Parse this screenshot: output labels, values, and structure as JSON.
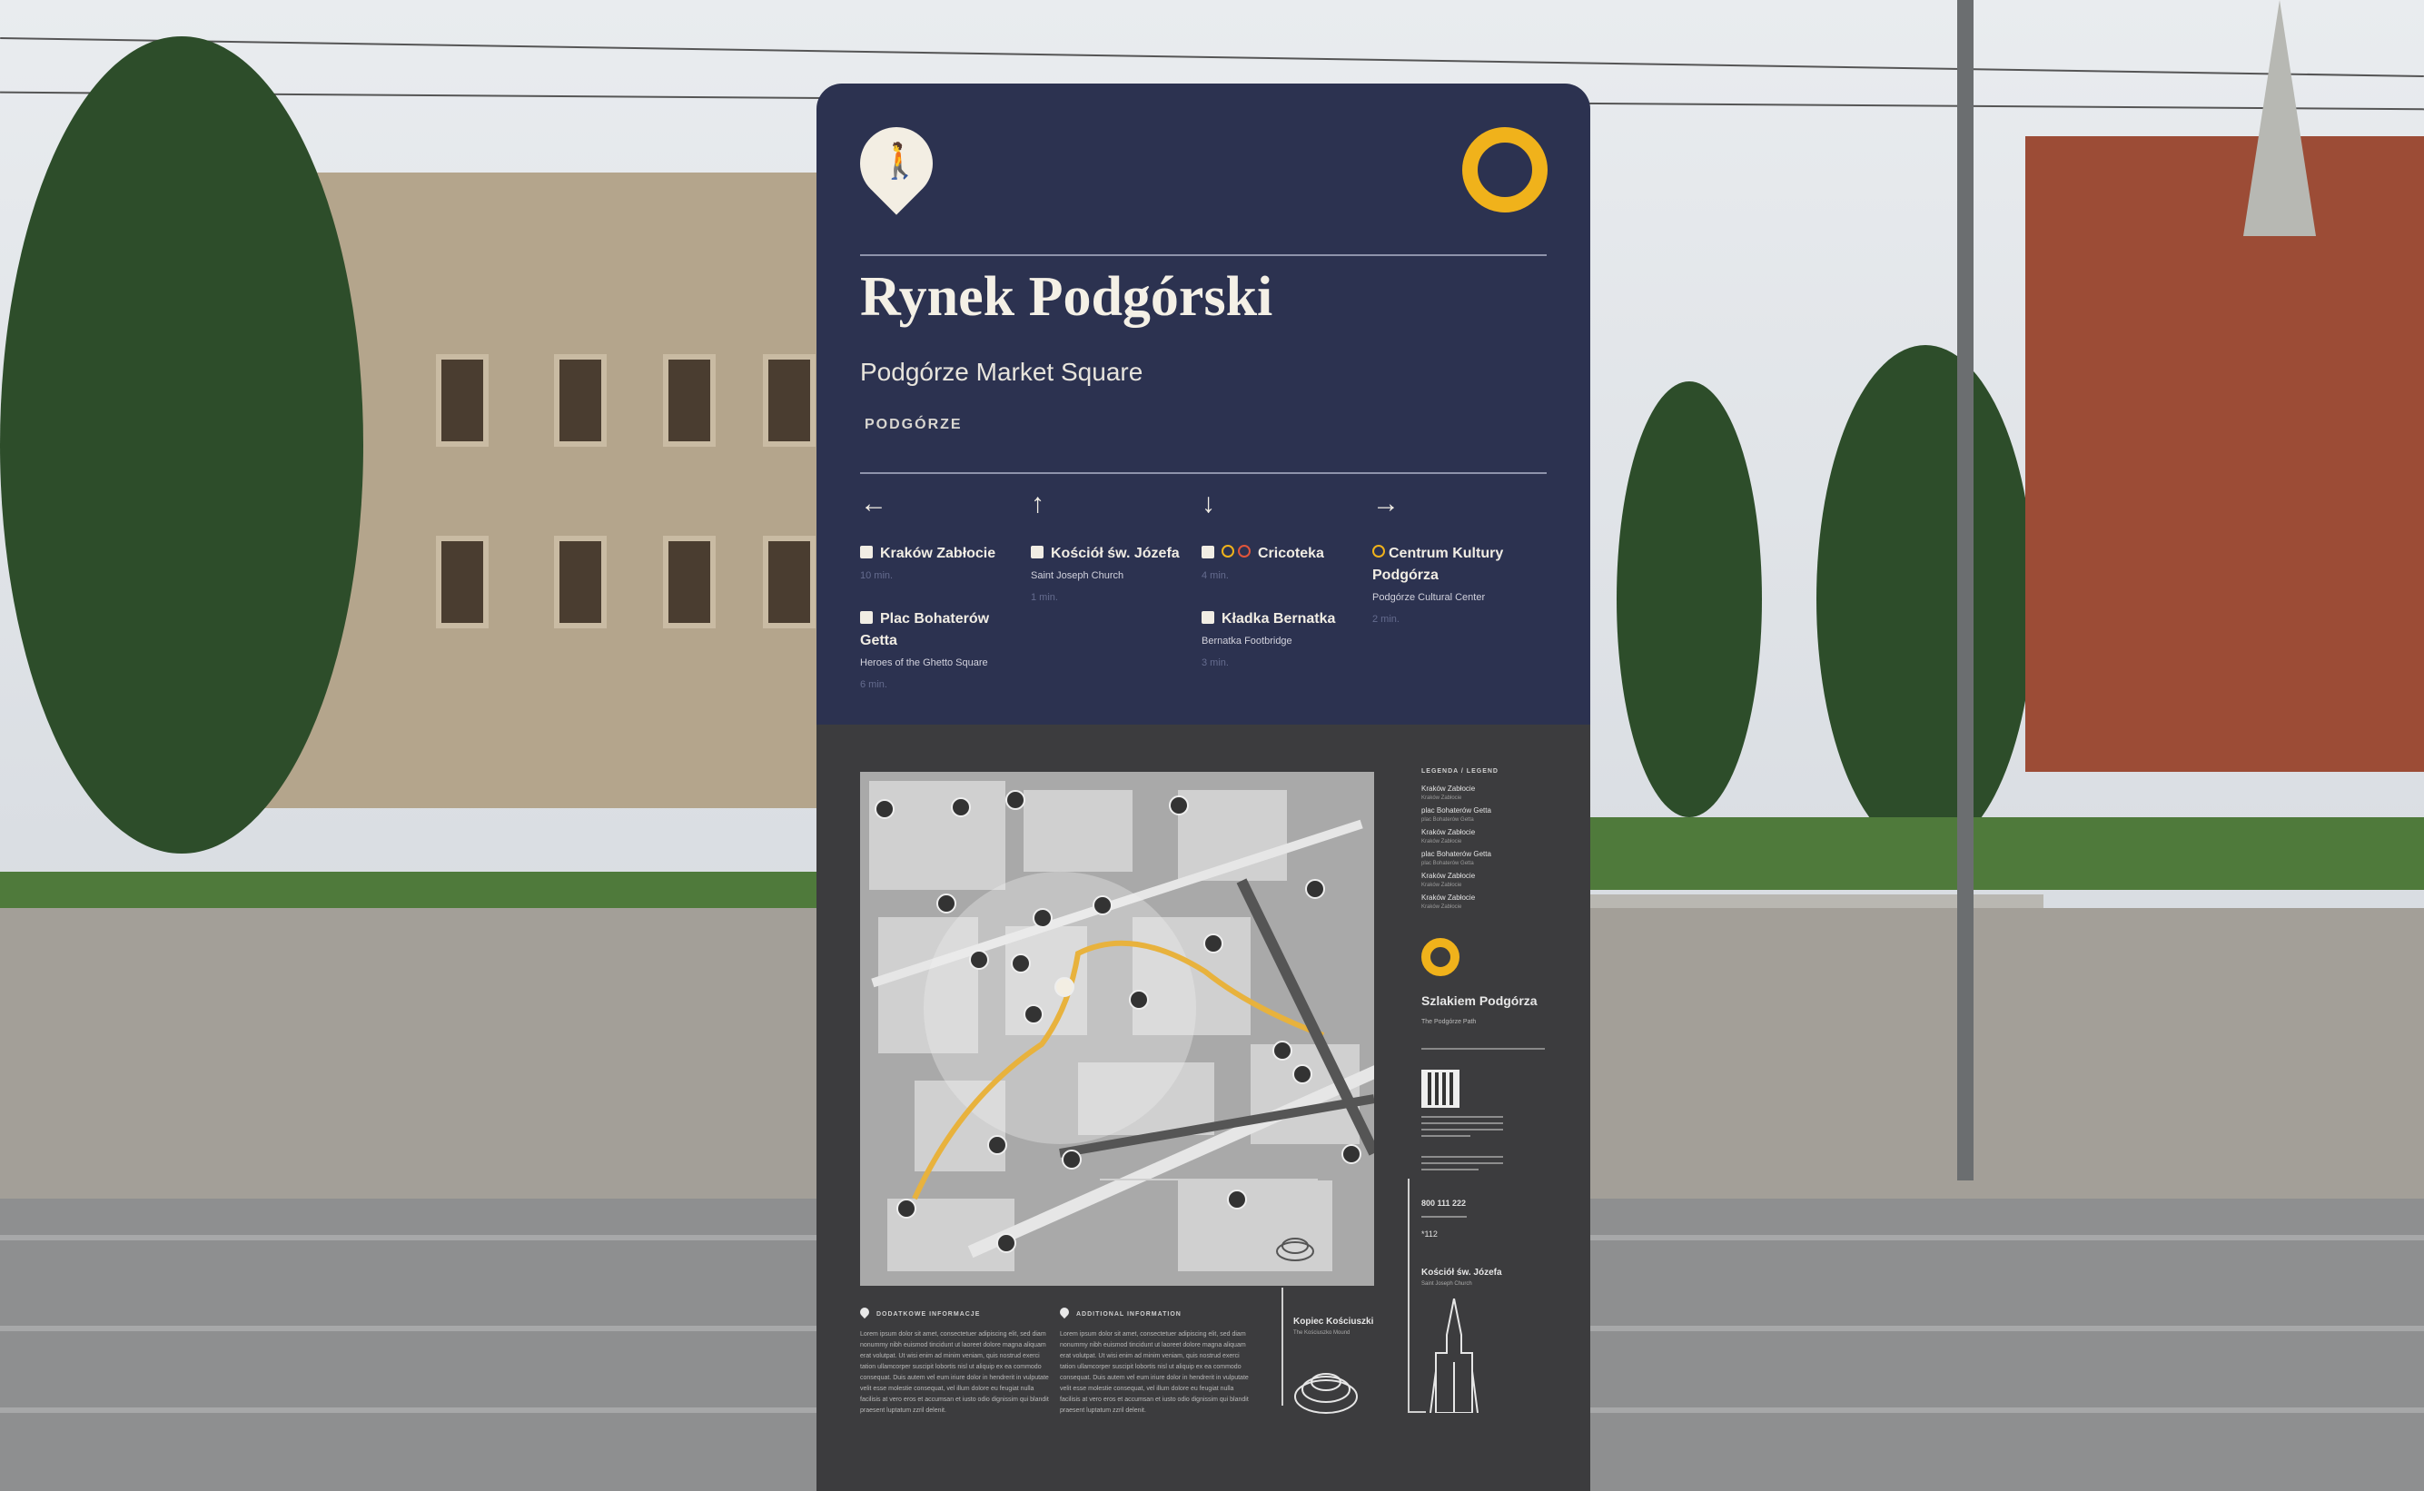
{
  "sign": {
    "title": "Rynek Podgórski",
    "subtitle": "Podgórze Market Square",
    "district": "PODGÓRZE",
    "accent_color": "#f0b21b",
    "panel_color": "#2c3250",
    "walk_icon": "pedestrian-icon",
    "route_icon": "ring-icon"
  },
  "directions": [
    {
      "arrow": "←",
      "icon": "arrow-left-icon"
    },
    {
      "arrow": "↑",
      "icon": "arrow-up-icon"
    },
    {
      "arrow": "↓",
      "icon": "arrow-down-icon"
    },
    {
      "arrow": "→",
      "icon": "arrow-right-icon"
    }
  ],
  "destinations": {
    "left": [
      {
        "name": "Kraków Zabłocie",
        "sub": "",
        "time": "10 min.",
        "icon": "train-icon"
      },
      {
        "name": "Plac Bohaterów Getta",
        "sub": "Heroes of the Ghetto Square",
        "time": "6 min.",
        "icon": "museum-icon"
      }
    ],
    "up": [
      {
        "name": "Kościół św. Józefa",
        "sub": "Saint Joseph Church",
        "time": "1 min.",
        "icon": "church-icon"
      }
    ],
    "down": [
      {
        "name": "Cricoteka",
        "sub": "",
        "time": "4 min.",
        "icon": "museum-icon"
      },
      {
        "name": "Kładka Bernatka",
        "sub": "Bernatka Footbridge",
        "time": "3 min.",
        "icon": "bridge-icon"
      }
    ],
    "right": [
      {
        "name": "Centrum Kultury Podgórza",
        "sub": "Podgórze Cultural Center",
        "time": "2 min.",
        "icon": "ring-icon"
      }
    ]
  },
  "legend": {
    "heading": "LEGENDA / LEGEND",
    "items": [
      {
        "name": "Kraków Zabłocie",
        "sub": "Kraków Zabłocie"
      },
      {
        "name": "plac Bohaterów Getta",
        "sub": "plac Bohaterów Getta"
      },
      {
        "name": "Kraków Zabłocie",
        "sub": "Kraków Zabłocie"
      },
      {
        "name": "plac Bohaterów Getta",
        "sub": "plac Bohaterów Getta"
      },
      {
        "name": "Kraków Zabłocie",
        "sub": "Kraków Zabłocie"
      },
      {
        "name": "Kraków Zabłocie",
        "sub": "Kraków Zabłocie"
      }
    ]
  },
  "route": {
    "title": "Szlakiem Podgórza",
    "subtitle": "The Podgórze Path"
  },
  "contact": {
    "phone": "800 111 222",
    "emergency": "*112"
  },
  "landmarks": {
    "church": {
      "name": "Kościół św. Józefa",
      "sub": "Saint Joseph Church"
    },
    "mound": {
      "name": "Kopiec Kościuszki",
      "sub": "The Kościuszko Mound"
    }
  },
  "info": {
    "pl_heading": "DODATKOWE INFORMACJE",
    "en_heading": "ADDITIONAL INFORMATION",
    "pl_text": "Lorem ipsum dolor sit amet, consectetuer adipiscing elit, sed diam nonummy nibh euismod tincidunt ut laoreet dolore magna aliquam erat volutpat. Ut wisi enim ad minim veniam, quis nostrud exerci tation ullamcorper suscipit lobortis nisl ut aliquip ex ea commodo consequat. Duis autem vel eum iriure dolor in hendrerit in vulputate velit esse molestie consequat, vel illum dolore eu feugiat nulla facilisis at vero eros et accumsan et iusto odio dignissim qui blandit praesent luptatum zzril delenit.",
    "en_text": "Lorem ipsum dolor sit amet, consectetuer adipiscing elit, sed diam nonummy nibh euismod tincidunt ut laoreet dolore magna aliquam erat volutpat. Ut wisi enim ad minim veniam, quis nostrud exerci tation ullamcorper suscipit lobortis nisl ut aliquip ex ea commodo consequat. Duis autem vel eum iriure dolor in hendrerit in vulputate velit esse molestie consequat, vel illum dolore eu feugiat nulla facilisis at vero eros et accumsan et iusto odio dignissim qui blandit praesent luptatum zzril delenit."
  }
}
